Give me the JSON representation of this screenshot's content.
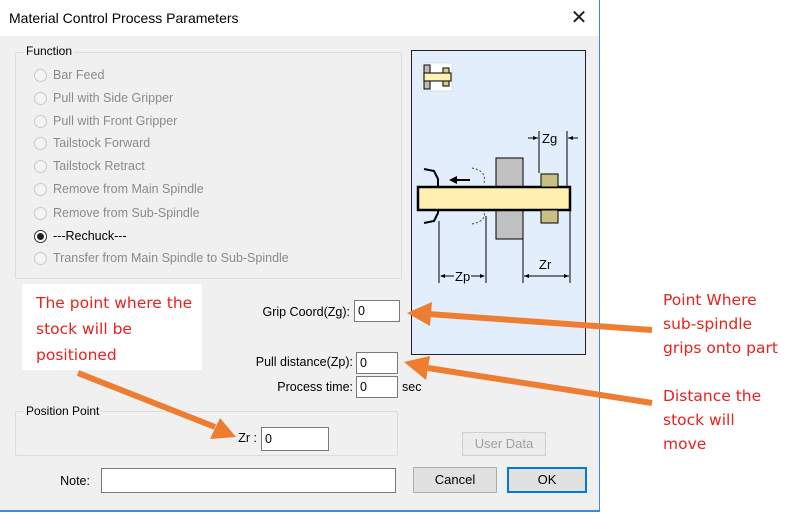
{
  "window": {
    "title": "Material Control Process Parameters",
    "close_icon": "close-icon"
  },
  "function_group": {
    "legend": "Function",
    "options": [
      {
        "label": "Bar Feed",
        "checked": false,
        "enabled": false
      },
      {
        "label": "Pull with Side Gripper",
        "checked": false,
        "enabled": false
      },
      {
        "label": "Pull with Front Gripper",
        "checked": false,
        "enabled": false
      },
      {
        "label": "Tailstock Forward",
        "checked": false,
        "enabled": false
      },
      {
        "label": "Tailstock Retract",
        "checked": false,
        "enabled": false
      },
      {
        "label": "Remove from Main Spindle",
        "checked": false,
        "enabled": false
      },
      {
        "label": "Remove from Sub-Spindle",
        "checked": false,
        "enabled": false
      },
      {
        "label": "---Rechuck---",
        "checked": true,
        "enabled": true
      },
      {
        "label": "Transfer from Main Spindle to Sub-Spindle",
        "checked": false,
        "enabled": false
      }
    ]
  },
  "diagram": {
    "icon": "rechuck-icon",
    "labels": {
      "zg": "Zg",
      "zp": "Zp",
      "zr": "Zr"
    }
  },
  "fields": {
    "grip_coord": {
      "label": "Grip Coord(Zg):",
      "value": "0"
    },
    "pull_distance": {
      "label": "Pull distance(Zp):",
      "value": "0"
    },
    "process_time": {
      "label": "Process time:",
      "value": "0",
      "unit": "sec"
    }
  },
  "position_group": {
    "legend": "Position Point",
    "zr": {
      "label": "Zr :",
      "value": "0"
    }
  },
  "note": {
    "label": "Note:",
    "value": ""
  },
  "buttons": {
    "user_data": "User Data",
    "cancel": "Cancel",
    "ok": "OK"
  },
  "annotations": {
    "position_callout": "The point where the stock will be positioned",
    "grip_callout": "Point Where sub-spindle grips onto part",
    "distance_callout": "Distance the stock will move",
    "arrow_color": "#ed7d31",
    "text_color": "#e8201e"
  }
}
